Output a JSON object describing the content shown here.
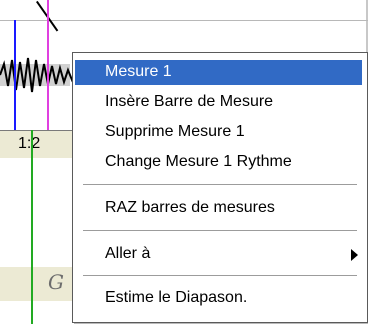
{
  "ruler": {
    "label": "1:2"
  },
  "clef": {
    "symbol": "G"
  },
  "context_menu": {
    "items": [
      {
        "label": "Mesure 1",
        "selected": true
      },
      {
        "label": "Insère Barre de Mesure"
      },
      {
        "label": "Supprime Mesure 1"
      },
      {
        "label": "Change Mesure 1 Rythme"
      },
      {
        "label": "RAZ barres de mesures"
      },
      {
        "label": "Aller à",
        "has_submenu": true
      },
      {
        "label": "Estime le Diapason."
      }
    ]
  },
  "colors": {
    "menu_highlight": "#316ac5",
    "marker_blue": "#1a1aff",
    "marker_pink": "#e040e0",
    "bar_line_green": "#22aa22",
    "ruler_bg": "#ecead4"
  }
}
